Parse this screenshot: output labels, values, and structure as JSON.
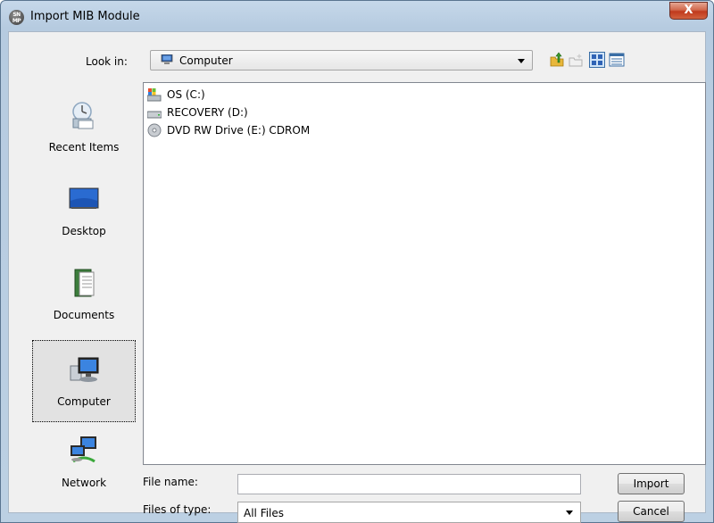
{
  "window": {
    "title": "Import MIB Module",
    "close_glyph": "X"
  },
  "toolbar": {
    "look_in_label": "Look in:",
    "look_in_value": "Computer",
    "icons": [
      "up-folder-icon",
      "new-folder-icon",
      "list-view-icon",
      "details-view-icon"
    ]
  },
  "places": [
    {
      "label": "Recent Items",
      "icon": "recent-items-icon"
    },
    {
      "label": "Desktop",
      "icon": "desktop-icon"
    },
    {
      "label": "Documents",
      "icon": "documents-icon"
    },
    {
      "label": "Computer",
      "icon": "computer-icon",
      "selected": true
    },
    {
      "label": "Network",
      "icon": "network-icon"
    }
  ],
  "files": [
    {
      "name": "OS (C:)",
      "icon": "system-drive-icon"
    },
    {
      "name": "RECOVERY (D:)",
      "icon": "hard-drive-icon"
    },
    {
      "name": "DVD RW Drive (E:) CDROM",
      "icon": "dvd-drive-icon"
    }
  ],
  "form": {
    "file_name_label": "File name:",
    "file_name_value": "",
    "files_of_type_label": "Files of type:",
    "files_of_type_value": "All Files"
  },
  "buttons": {
    "import": "Import",
    "cancel": "Cancel"
  }
}
